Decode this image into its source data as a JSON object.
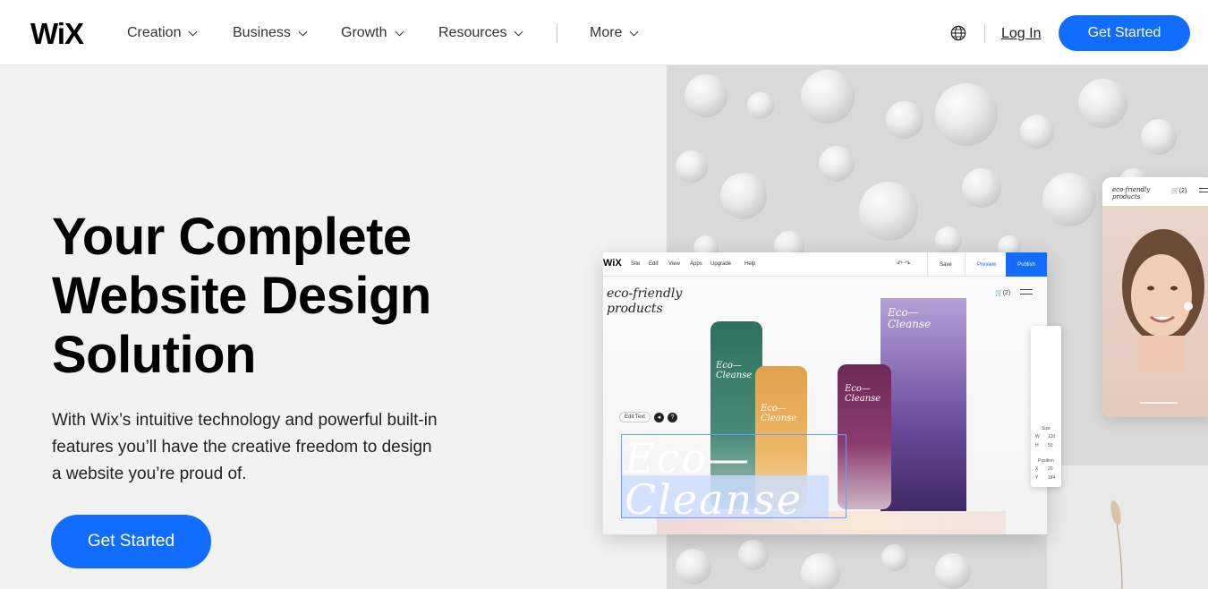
{
  "header": {
    "logo": "WiX",
    "nav": [
      {
        "label": "Creation"
      },
      {
        "label": "Business"
      },
      {
        "label": "Growth"
      },
      {
        "label": "Resources"
      },
      {
        "label": "More"
      }
    ],
    "login_label": "Log In",
    "cta_label": "Get Started"
  },
  "hero": {
    "title_lines": [
      "Your Complete",
      "Website Design",
      "Solution"
    ],
    "subtitle_lines": [
      "With Wix’s intuitive technology and powerful built-in",
      "features you’ll have the creative freedom to design",
      "a website you’re proud of."
    ],
    "cta_label": "Get Started"
  },
  "editor_mock": {
    "logo": "WiX",
    "menu": [
      "Site",
      "Edit",
      "View",
      "Apps",
      "Upgrade",
      "Help"
    ],
    "save": "Save",
    "preview": "Preview",
    "publish": "Publish",
    "brand_lines": [
      "eco-friendly",
      "products"
    ],
    "cart": "(2)",
    "edit_text": "Edit Text",
    "headline_lines": [
      "Eco—",
      "Cleanse"
    ],
    "product_label_lines": [
      "Eco—",
      "Cleanse"
    ],
    "panel": {
      "size": "Size",
      "w_label": "W",
      "w_value": "120",
      "h_label": "H",
      "h_value": "50",
      "position": "Position",
      "x_label": "X",
      "x_value": "20",
      "y_label": "Y",
      "y_value": "184"
    }
  },
  "phone_mock": {
    "brand_lines": [
      "eco-friendly",
      "products"
    ],
    "cart": "(2)"
  },
  "colors": {
    "accent": "#116dff",
    "hero_bg": "#f2f2f2",
    "text": "#000000"
  }
}
